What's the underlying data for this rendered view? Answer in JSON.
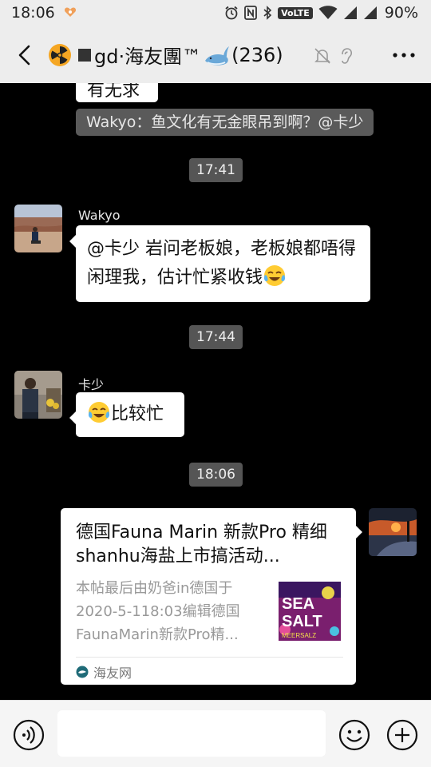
{
  "status_bar": {
    "time": "18:06",
    "network_label": "VoLTE",
    "battery": "90%"
  },
  "header": {
    "title_text": "gd·海友團™",
    "member_count": "(236)",
    "icons": [
      "back-icon",
      "radioactive-emoji",
      "whale-emoji",
      "mute-bell-icon",
      "ear-icon",
      "more-icon"
    ]
  },
  "chat": {
    "cut_message": "有无求",
    "quote_text": "Wakyo：鱼文化有无金眼吊到啊？@卡少",
    "time_1": "17:41",
    "msg1": {
      "sender": "Wakyo",
      "text": "@卡少  岩问老板娘，老板娘都唔得闲理我，估计忙紧收钱"
    },
    "time_2": "17:44",
    "msg2": {
      "sender": "卡少",
      "text": "比较忙"
    },
    "time_3": "18:06",
    "link_card": {
      "title": "德国Fauna Marin 新款Pro 精细shanhu海盐上市搞活动...",
      "description": "本帖最后由奶爸in德国于2020-5-118:03编辑德国FaunaMarin新款Pro精...",
      "thumb_text_1": "SEA",
      "thumb_text_2": "SALT",
      "thumb_text_3": "MEERSALZ",
      "source": "海友网"
    }
  },
  "input_bar": {
    "placeholder": ""
  },
  "colors": {
    "chat_bg": "#000000",
    "header_bg": "#ededed",
    "bubble_bg": "#ffffff",
    "time_pill_bg": "#555555",
    "quote_bg": "#5a5a5a"
  }
}
